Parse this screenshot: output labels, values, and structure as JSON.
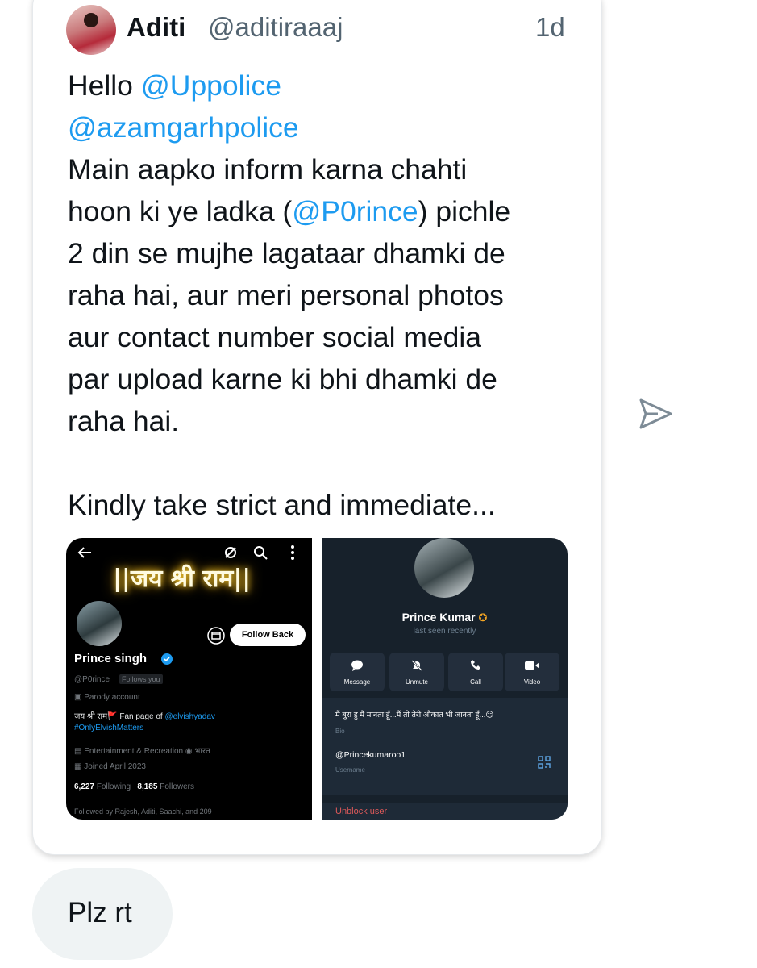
{
  "tweet": {
    "author_name": "Aditi",
    "author_handle": "@aditiraaaj",
    "time": "1d",
    "line1_prefix": "Hello ",
    "mention1": "@Uppolice",
    "mention2": "@azamgarhpolice",
    "line3": "Main aapko inform karna chahti",
    "line4_prefix": "hoon ki ye ladka (",
    "mention3": "@P0rince",
    "line4_suffix": ") pichle",
    "line5": "2 din se mujhe lagataar dhamki de",
    "line6": "raha hai, aur meri personal photos",
    "line7": "aur contact number social media",
    "line8": "par upload karne ki bhi dhamki de",
    "line9": "raha hai.",
    "line10": "Kindly take strict and immediate..."
  },
  "profile_shot": {
    "banner_text": "||जय श्री राम||",
    "follow_back_label": "Follow Back",
    "name": "Prince singh",
    "handle": "@P0rince",
    "follows_you": "Follows you",
    "parody": "Parody account",
    "bio_prefix": "जय श्री राम🚩 Fan page of ",
    "bio_mention": "@elvishyadav",
    "hashtag": "#OnlyElvishMatters",
    "category": "Entertainment & Recreation",
    "location": "भारत",
    "joined": "Joined April 2023",
    "following_count": "6,227",
    "following_label": "Following",
    "followers_count": "8,185",
    "followers_label": "Followers",
    "followed_by": "Followed by Rajesh, Aditi, Saachi, and 209"
  },
  "telegram_shot": {
    "name": "Prince Kumar",
    "status": "last seen recently",
    "actions": [
      "Message",
      "Unmute",
      "Call",
      "Video"
    ],
    "bio": "मैं बुरा हु मैं मानता हूँ...मैं तो तेरी औकात भी जानता हूँ...😏",
    "bio_label": "Bio",
    "username": "@Princekumaroo1",
    "username_label": "Username",
    "unblock_label": "Unblock user"
  },
  "reply": {
    "text": "Plz rt"
  },
  "colors": {
    "link": "#1d9bf0",
    "telegram_bg": "#17212b",
    "telegram_red": "#e05a5a",
    "verified": "#1d9bf0"
  },
  "icons": [
    "send-icon",
    "back-arrow-icon",
    "search-icon",
    "more-icon",
    "message-icon",
    "mute-icon",
    "call-icon",
    "video-icon",
    "qr-code-icon",
    "verified-badge-icon"
  ]
}
